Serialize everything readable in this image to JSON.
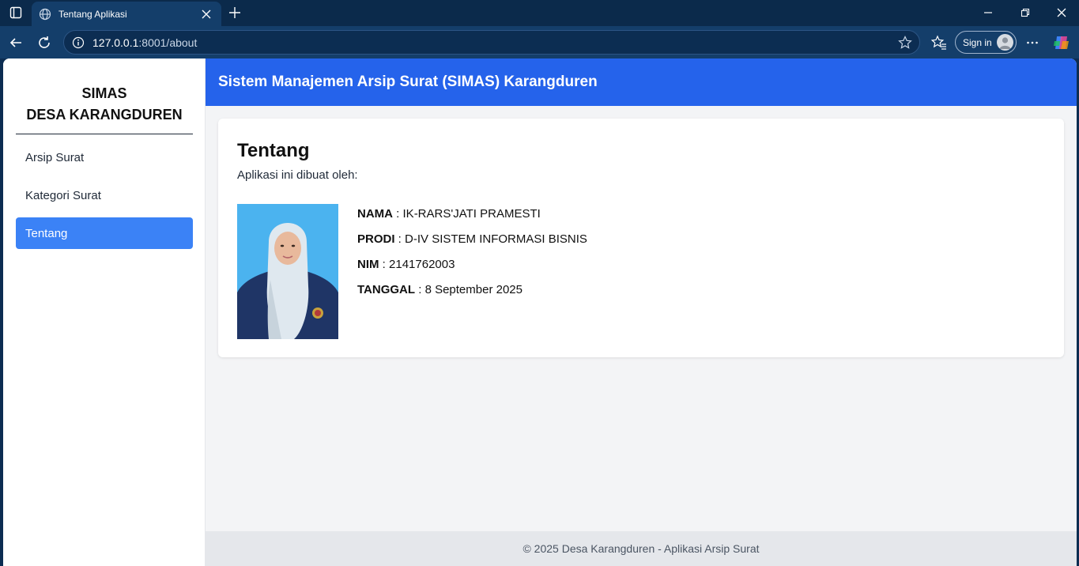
{
  "browser": {
    "tab_title": "Tentang Aplikasi",
    "url_host": "127.0.0.1",
    "url_rest": ":8001/about",
    "sign_in_label": "Sign in"
  },
  "sidebar": {
    "brand_line1": "SIMAS",
    "brand_line2": "DESA KARANGDUREN",
    "items": [
      {
        "label": "Arsip Surat",
        "active": false
      },
      {
        "label": "Kategori Surat",
        "active": false
      },
      {
        "label": "Tentang",
        "active": true
      }
    ]
  },
  "header": {
    "title": "Sistem Manajemen Arsip Surat (SIMAS) Karangduren"
  },
  "about": {
    "title": "Tentang",
    "subtitle": "Aplikasi ini dibuat oleh:",
    "details": [
      {
        "label": "NAMA",
        "value": "IK-RARS'JATI PRAMESTI"
      },
      {
        "label": "PRODI",
        "value": "D-IV SISTEM INFORMASI BISNIS"
      },
      {
        "label": "NIM",
        "value": "2141762003"
      },
      {
        "label": "TANGGAL",
        "value": "8 September 2025"
      }
    ]
  },
  "footer": {
    "text": "© 2025 Desa Karangduren - Aplikasi Arsip Surat"
  },
  "colors": {
    "header_blue": "#2563eb",
    "active_nav": "#3b82f6",
    "photo_bg": "#4bb3ef"
  }
}
